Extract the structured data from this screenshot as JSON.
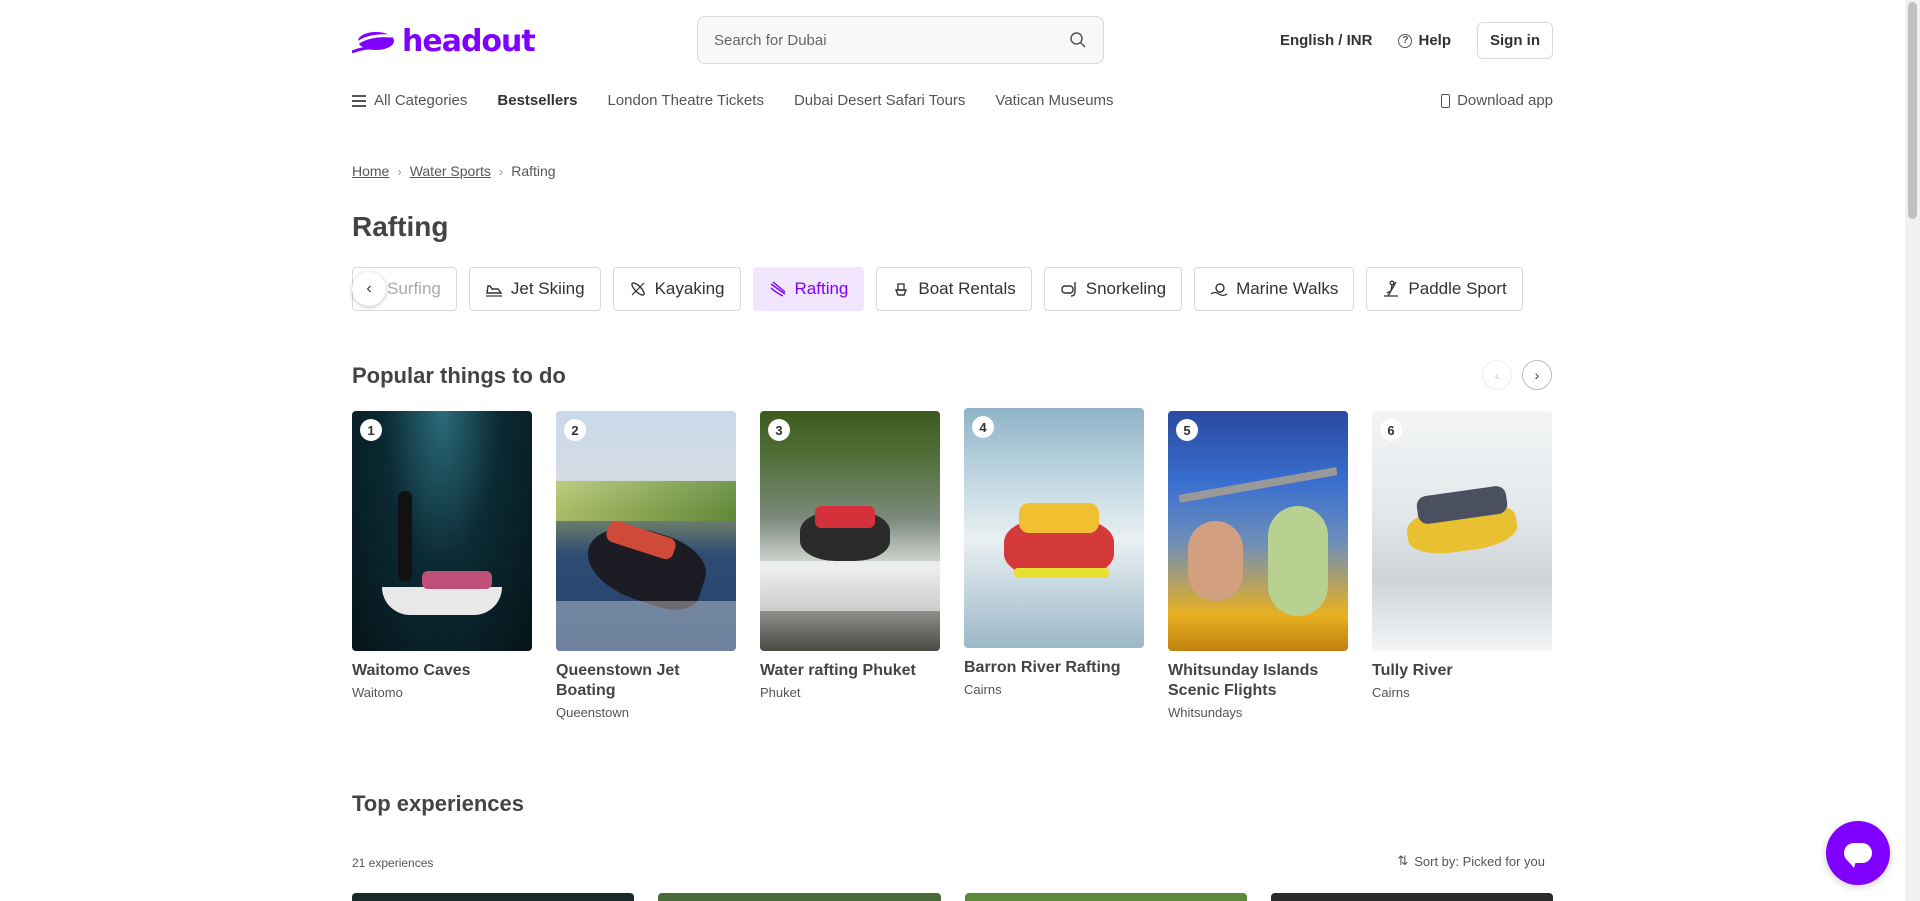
{
  "header": {
    "logo_text": "headout",
    "search_placeholder": "Search for Dubai",
    "language": "English / INR",
    "help": "Help",
    "sign_in": "Sign in"
  },
  "nav": {
    "all_categories": "All Categories",
    "items": [
      "Bestsellers",
      "London Theatre Tickets",
      "Dubai Desert Safari Tours",
      "Vatican Museums"
    ],
    "download_app": "Download app"
  },
  "breadcrumb": {
    "home": "Home",
    "water_sports": "Water Sports",
    "current": "Rafting"
  },
  "page_title": "Rafting",
  "categories": [
    {
      "label": "Surfing",
      "icon": "surfing-icon"
    },
    {
      "label": "Jet Skiing",
      "icon": "jet-ski-icon"
    },
    {
      "label": "Kayaking",
      "icon": "kayak-icon"
    },
    {
      "label": "Rafting",
      "icon": "rafting-icon",
      "active": true
    },
    {
      "label": "Boat Rentals",
      "icon": "boat-icon"
    },
    {
      "label": "Snorkeling",
      "icon": "snorkel-icon"
    },
    {
      "label": "Marine Walks",
      "icon": "marine-walk-icon"
    },
    {
      "label": "Paddle Sport",
      "icon": "paddle-icon"
    }
  ],
  "popular": {
    "title": "Popular things to do",
    "cards": [
      {
        "rank": "1",
        "title": "Waitomo Caves",
        "location": "Waitomo"
      },
      {
        "rank": "2",
        "title": "Queenstown Jet Boating",
        "location": "Queenstown"
      },
      {
        "rank": "3",
        "title": "Water rafting Phuket",
        "location": "Phuket"
      },
      {
        "rank": "4",
        "title": "Barron River Rafting",
        "location": "Cairns"
      },
      {
        "rank": "5",
        "title": "Whitsunday Islands Scenic Flights",
        "location": "Whitsundays"
      },
      {
        "rank": "6",
        "title": "Tully River",
        "location": "Cairns"
      }
    ]
  },
  "top_experiences": {
    "title": "Top experiences",
    "count": "21 experiences",
    "sort": "Sort by: Picked for you"
  },
  "colors": {
    "brand": "#8000ff",
    "chip_active_bg": "#f2e6ff"
  }
}
